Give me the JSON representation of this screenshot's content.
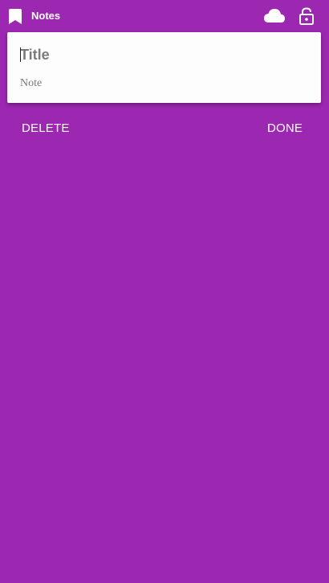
{
  "app_bar": {
    "title": "Notes",
    "icons": [
      "bookmark-icon",
      "cloud-icon",
      "lock-open-icon"
    ]
  },
  "note": {
    "title_placeholder": "Title",
    "title_value": "",
    "note_placeholder": "Note",
    "note_value": ""
  },
  "actions": {
    "delete_label": "DELETE",
    "done_label": "DONE"
  },
  "colors": {
    "background": "#9c27b0",
    "card": "#fdfdfd",
    "text_on_primary": "#ffffff",
    "placeholder": "#7a7a7a"
  }
}
